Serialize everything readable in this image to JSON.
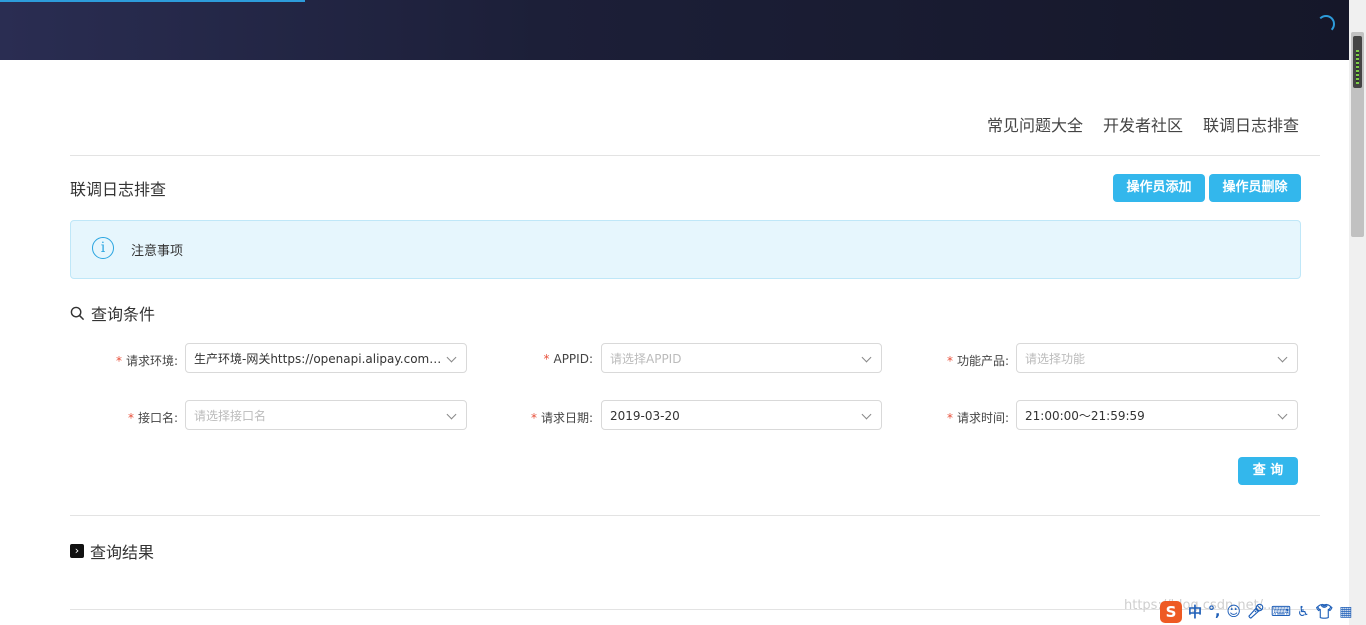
{
  "header": {
    "links": [
      "常见问题大全",
      "开发者社区",
      "联调日志排查"
    ]
  },
  "page": {
    "title": "联调日志排查",
    "add_operator_label": "操作员添加",
    "delete_operator_label": "操作员删除"
  },
  "notice": {
    "icon": "info-icon",
    "text": "注意事项"
  },
  "query": {
    "section_title": "查询条件",
    "fields": {
      "env": {
        "label": "请求环境:",
        "value": "生产环境-网关https://openapi.alipay.com/ga...",
        "required": true
      },
      "appid": {
        "label": "APPID:",
        "placeholder": "请选择APPID",
        "required": true
      },
      "product": {
        "label": "功能产品:",
        "placeholder": "请选择功能",
        "required": true
      },
      "api": {
        "label": "接口名:",
        "placeholder": "请选择接口名",
        "required": true
      },
      "date": {
        "label": "请求日期:",
        "value": "2019-03-20",
        "required": true
      },
      "time": {
        "label": "请求时间:",
        "value": "21:00:00～21:59:59",
        "required": true
      }
    },
    "submit_label": "查 询"
  },
  "results": {
    "section_title": "查询结果"
  },
  "taskbar": {
    "ime_lang": "中",
    "watermark": "https://blog.csdn.net/..."
  },
  "colors": {
    "primary": "#33b7ec",
    "header_bg": "#1c1f38",
    "notice_bg": "#e6f6fd",
    "required": "#e8503a"
  }
}
